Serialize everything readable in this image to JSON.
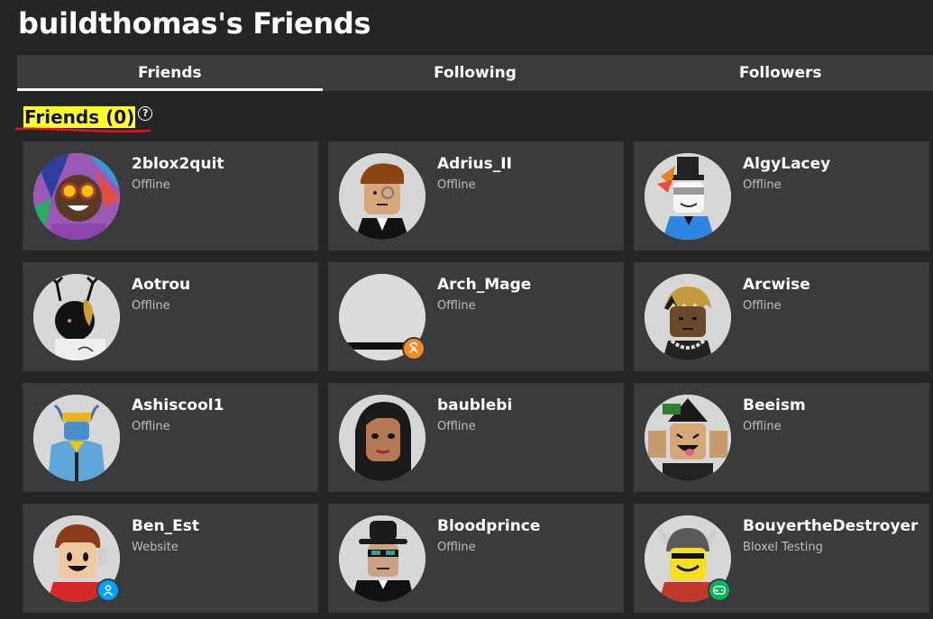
{
  "page": {
    "title": "buildthomas's Friends"
  },
  "tabs": [
    {
      "label": "Friends",
      "active": true
    },
    {
      "label": "Following",
      "active": false
    },
    {
      "label": "Followers",
      "active": false
    }
  ],
  "section": {
    "title": "Friends (0)",
    "help_icon": "?"
  },
  "colors": {
    "background": "#232527",
    "card": "#393b3d",
    "highlight": "#ffff2a",
    "annotation": "#e3141c",
    "studio_badge": "#f5891f",
    "user_badge": "#00a2ff",
    "game_badge": "#02b757"
  },
  "friends": [
    {
      "name": "2blox2quit",
      "status": "Offline",
      "badge": null
    },
    {
      "name": "Adrius_II",
      "status": "Offline",
      "badge": null
    },
    {
      "name": "AlgyLacey",
      "status": "Offline",
      "badge": null
    },
    {
      "name": "Aotrou",
      "status": "Offline",
      "badge": null
    },
    {
      "name": "Arch_Mage",
      "status": "Offline",
      "badge": "studio-icon"
    },
    {
      "name": "Arcwise",
      "status": "Offline",
      "badge": null
    },
    {
      "name": "Ashiscool1",
      "status": "Offline",
      "badge": null
    },
    {
      "name": "baublebi",
      "status": "Offline",
      "badge": null
    },
    {
      "name": "Beeism",
      "status": "Offline",
      "badge": null
    },
    {
      "name": "Ben_Est",
      "status": "Website",
      "badge": "user-icon"
    },
    {
      "name": "Bloodprince",
      "status": "Offline",
      "badge": null
    },
    {
      "name": "BouyertheDestroyer",
      "status": "Bloxel Testing",
      "badge": "gamepad-icon"
    }
  ]
}
